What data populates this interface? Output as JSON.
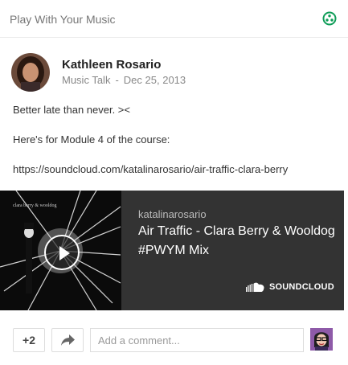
{
  "header": {
    "community_name": "Play With Your Music",
    "community_icon": "community-circles-icon",
    "accent_color": "#0f9d58"
  },
  "post": {
    "author": "Kathleen Rosario",
    "category": "Music Talk",
    "separator": "-",
    "date": "Dec 25, 2013",
    "lines": [
      "Better late than never. ><",
      "Here's for Module 4 of the course:",
      "https://soundcloud.com/katalinarosario/air-traffic-clara-berry"
    ]
  },
  "embed": {
    "artwork_caption": "clara berry & wooldog",
    "username": "katalinarosario",
    "title": "Air Traffic - Clara Berry & Wooldog #PWYM Mix",
    "brand": "SOUNDCLOUD",
    "play_icon": "play-icon",
    "background_color": "#333333"
  },
  "actions": {
    "plus_count": "+2",
    "share_icon": "share-icon",
    "comment_placeholder": "Add a comment..."
  }
}
